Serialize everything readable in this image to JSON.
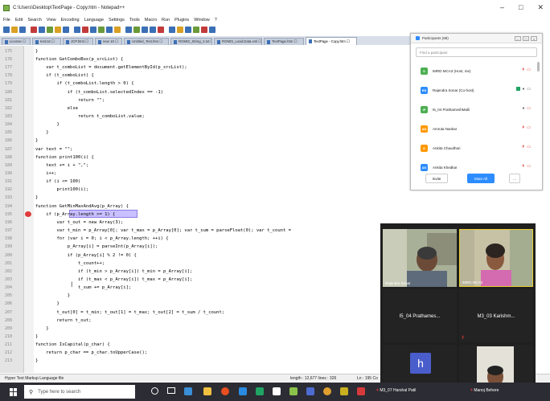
{
  "window": {
    "title": "C:\\Users\\Desktop\\TextPage - Copy.htm - Notepad++",
    "controls": [
      "–",
      "□",
      "✕"
    ]
  },
  "menu": [
    "File",
    "Edit",
    "Search",
    "View",
    "Encoding",
    "Language",
    "Settings",
    "Tools",
    "Macro",
    "Run",
    "Plugins",
    "Window",
    "?"
  ],
  "toolbar_colors": [
    "#3b6fb6",
    "#d9a126",
    "#3b6fb6",
    "#c23b3b",
    "#3b6fb6",
    "#6a9a3a",
    "#d9a126",
    "#3b6fb6",
    "#3b6fb6",
    "#c23b3b",
    "#3b6fb6",
    "#6a9a3a",
    "#3b6fb6",
    "#d9a126",
    "#3b6fb6",
    "#6a9a3a",
    "#3b6fb6",
    "#3b6fb6",
    "#c23b3b",
    "#3b6fb6",
    "#d9a126",
    "#3b6fb6",
    "#6a9a3a",
    "#c23b3b",
    "#3b6fb6"
  ],
  "tabs": [
    {
      "label": "License ☐",
      "active": false
    },
    {
      "label": "test.txt ☐",
      "active": false
    },
    {
      "label": "JCP.html ☐",
      "active": false
    },
    {
      "label": "new 10 ☐",
      "active": false
    },
    {
      "label": "Untitled_Test.htm ☐",
      "active": false
    },
    {
      "label": "ROMIS_String_2.txt ☐",
      "active": false
    },
    {
      "label": "ROMIS_Load.Data.xml ☐",
      "active": false
    },
    {
      "label": "TextPage.htm ☐",
      "active": false
    },
    {
      "label": "TextPage - Copy.htm ☐",
      "active": true
    }
  ],
  "code": [
    {
      "n": "175",
      "t": "}"
    },
    {
      "n": "176",
      "t": "function GetComboBox(p_srcList) {"
    },
    {
      "n": "177",
      "t": "    var t_comboList = document.getElementById(p_srcList);"
    },
    {
      "n": "178",
      "t": "    if (t_comboList) {"
    },
    {
      "n": "179",
      "t": "        if (t_comboList.length > 0) {"
    },
    {
      "n": "180",
      "t": "            if (t_comboList.selectedIndex == -1)"
    },
    {
      "n": "181",
      "t": "                return \"\";"
    },
    {
      "n": "182",
      "t": "            else"
    },
    {
      "n": "183",
      "t": "                return t_comboList.value;"
    },
    {
      "n": "184",
      "t": "        }"
    },
    {
      "n": "185",
      "t": "    }"
    },
    {
      "n": "186",
      "t": "}"
    },
    {
      "n": "187",
      "t": "var text = \"\";"
    },
    {
      "n": "188",
      "t": "function print100(i) {"
    },
    {
      "n": "189",
      "t": "    text += i + \",\";"
    },
    {
      "n": "190",
      "t": "    i++;"
    },
    {
      "n": "191",
      "t": "    if (i <= 100)"
    },
    {
      "n": "192",
      "t": "        print100(i);"
    },
    {
      "n": "193",
      "t": "}"
    },
    {
      "n": "194",
      "t": "function GetMinMaxAndAvg(p_Array) {"
    },
    {
      "n": "195",
      "t": "    if (p_Array.length >= 1) {"
    },
    {
      "n": "196",
      "t": "        var t_out = new Array(3);"
    },
    {
      "n": "197",
      "t": "        var t_min = p_Array[0]; var t_max = p_Array[0]; var t_sum = parseFloat(0); var t_count ="
    },
    {
      "n": "198",
      "t": "        for (var i = 0; i < p_Array.length; ++i) {"
    },
    {
      "n": "199",
      "t": "            p_Array[i] = parseInt(p_Array[i]);"
    },
    {
      "n": "200",
      "t": "            if (p_Array[i] % 2 != 0) {"
    },
    {
      "n": "201",
      "t": "                t_count++;"
    },
    {
      "n": "202",
      "t": "                if (t_min > p_Array[i]) t_min = p_Array[i];"
    },
    {
      "n": "203",
      "t": "                if (t_max < p_Array[i]) t_max = p_Array[i];"
    },
    {
      "n": "204",
      "t": "                t_sum += p_Array[i];"
    },
    {
      "n": "205",
      "t": "            }"
    },
    {
      "n": "206",
      "t": "        }"
    },
    {
      "n": "207",
      "t": "        t_out[0] = t_min; t_out[1] = t_max; t_out[2] = t_sum / t_count;"
    },
    {
      "n": "208",
      "t": "        return t_out;"
    },
    {
      "n": "209",
      "t": "    }"
    },
    {
      "n": "210",
      "t": "}"
    },
    {
      "n": "211",
      "t": "function IsCapital(p_char) {"
    },
    {
      "n": "212",
      "t": "    return p_char == p_char.toUpperCase();"
    },
    {
      "n": "213",
      "t": "}"
    }
  ],
  "highlighted_line": "195",
  "status": {
    "language": "Hyper Text Markup Language file",
    "length": "length : 12,677   lines : 326",
    "position": "Ln : 195   Co"
  },
  "participants": {
    "title": "Participants (88)",
    "find_placeholder": "Find a participant",
    "people": [
      {
        "initial": "S",
        "name": "IMRD MCA3 (Host, me)",
        "color": "#4caf50",
        "mic": "off",
        "cam": "off"
      },
      {
        "initial": "RS",
        "name": "Rajendra Sonar (Co-host)",
        "color": "#2d8cff",
        "mic": "on",
        "cam": "on"
      },
      {
        "initial": "IP",
        "name": "I5_04 PrathameshMalli",
        "color": "#4caf50",
        "mic": "on",
        "cam": "off"
      },
      {
        "initial": "AN",
        "name": "Amruta Nankar",
        "color": "#ff9800",
        "mic": "off",
        "cam": "off"
      },
      {
        "initial": "A",
        "name": "Ankita Chaudhari",
        "color": "#ff9800",
        "mic": "off",
        "cam": "off"
      },
      {
        "initial": "AK",
        "name": "Ankita Khedkar",
        "color": "#2d8cff",
        "mic": "off",
        "cam": "off"
      }
    ],
    "invite_label": "Invite",
    "mute_all_label": "Mute All",
    "more_label": "..."
  },
  "video": {
    "tile1_name": "Rajendra Sonar",
    "tile2_name": "IMRD MCA3",
    "tile3_name": "I5_04 Prathames...",
    "tile4_name": "M3_03 Karishm...",
    "tile5_initial": "h"
  },
  "taskbar": {
    "search_placeholder": "Type here to search",
    "item1": "M3_07 Harshal Patil",
    "item2": "Manoj Behere"
  }
}
